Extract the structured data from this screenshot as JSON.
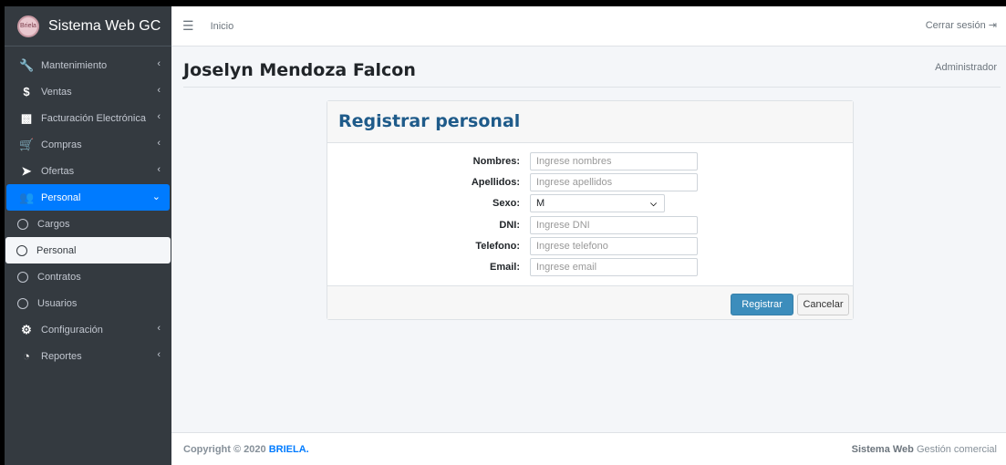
{
  "sidebar": {
    "brand": "Sistema Web GC",
    "logo_text": "Briela",
    "items": [
      {
        "label": "Mantenimiento"
      },
      {
        "label": "Ventas"
      },
      {
        "label": "Facturación Electrónica"
      },
      {
        "label": "Compras"
      },
      {
        "label": "Ofertas"
      },
      {
        "label": "Personal"
      },
      {
        "label": "Cargos"
      },
      {
        "label": "Personal"
      },
      {
        "label": "Contratos"
      },
      {
        "label": "Usuarios"
      },
      {
        "label": "Configuración"
      },
      {
        "label": "Reportes"
      }
    ]
  },
  "topbar": {
    "home": "Inicio",
    "logout": "Cerrar sesión"
  },
  "header": {
    "title": "Joselyn Mendoza Falcon",
    "role": "Administrador"
  },
  "form": {
    "title": "Registrar personal",
    "fields": {
      "nombres": {
        "label": "Nombres:",
        "placeholder": "Ingrese nombres"
      },
      "apellidos": {
        "label": "Apellidos:",
        "placeholder": "Ingrese apellidos"
      },
      "sexo": {
        "label": "Sexo:",
        "value": "M"
      },
      "dni": {
        "label": "DNI:",
        "placeholder": "Ingrese DNI"
      },
      "telefono": {
        "label": "Telefono:",
        "placeholder": "Ingrese telefono"
      },
      "email": {
        "label": "Email:",
        "placeholder": "Ingrese email"
      }
    },
    "submit": "Registrar",
    "cancel": "Cancelar"
  },
  "footer": {
    "copyright": "Copyright © 2020 ",
    "company": "BRIELA.",
    "system_bold": "Sistema Web",
    "system_rest": " Gestión comercial"
  },
  "colors": {
    "sidebar_bg": "#343a40",
    "active": "#007bff",
    "primary_button": "#3c8dbc"
  }
}
